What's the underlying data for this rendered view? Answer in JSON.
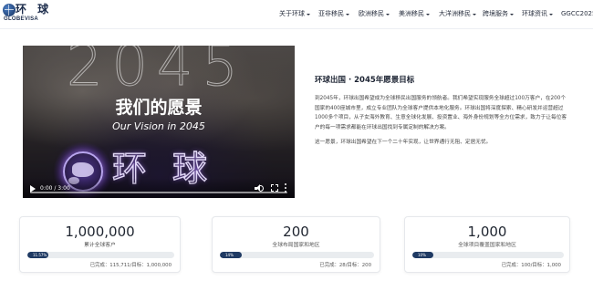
{
  "header": {
    "logo": {
      "cn": "环 球",
      "en": "GLOBEVISA"
    },
    "nav": [
      {
        "label": "关于环球",
        "has_dropdown": true
      },
      {
        "label": "亚非移民",
        "has_dropdown": true
      },
      {
        "label": "欧洲移民",
        "has_dropdown": true
      },
      {
        "label": "美洲移民",
        "has_dropdown": true
      },
      {
        "label": "大洋洲移民",
        "has_dropdown": true
      },
      {
        "label": "跨境服务",
        "has_dropdown": true
      },
      {
        "label": "环球资讯",
        "has_dropdown": true
      },
      {
        "label": "GGCC2025",
        "has_dropdown": false
      }
    ]
  },
  "video": {
    "year": "2045",
    "title_cn": "我们的愿景",
    "title_en": "Our Vision in 2045",
    "brand_text": "环球",
    "time": "0:00 / 3:00",
    "icons": {
      "play": "play-icon",
      "volume": "volume-icon",
      "fullscreen": "fullscreen-icon",
      "more": "more-options-icon"
    },
    "progress": 0
  },
  "article": {
    "title": "环球出国 · 2045年愿景目标",
    "paragraph1": "到2045年，环球出国希望成为全球移民出国服务的领航者。我们希望实现服务全球超过100万客户，在200个国家的400座城市里，成立专业团队为全球客户提供本地化服务。环球出国将深度探索、精心研发并运营超过1000多个项目，从子女海外教育、生意全球化发展、投资置业、海外身份规划等全方位需求，致力于让每位客户的每一项需求都能在环球出国找到专属定制的解决方案。",
    "paragraph2": "这一愿景，环球出国希望在下一个二十年实现，让世界通行无阻、定居无忧。"
  },
  "stats": [
    {
      "value": "1,000,000",
      "label": "累计全球客户",
      "percent_text": "11.57%",
      "percent": 11.57,
      "detail": "已完成：115,711/目标：1,000,000"
    },
    {
      "value": "200",
      "label": "全球布局国家和地区",
      "percent_text": "14%",
      "percent": 14,
      "detail": "已完成：28/目标：200"
    },
    {
      "value": "1,000",
      "label": "全球项目覆盖国家和地区",
      "percent_text": "10%",
      "percent": 10,
      "detail": "已完成：100/目标：1,000"
    }
  ],
  "colors": {
    "brand_navy": "#1f3a63",
    "progress_track": "#e9ecef",
    "text_dark": "#1d2433"
  }
}
